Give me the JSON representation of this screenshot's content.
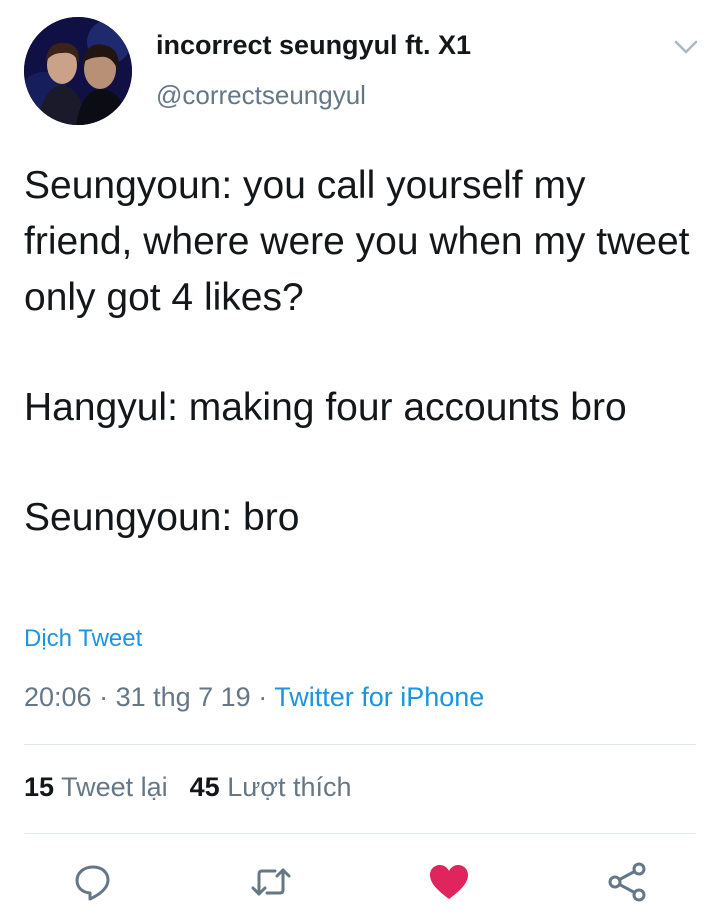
{
  "author": {
    "display_name": "incorrect seungyul ft. X1",
    "handle": "@correctseungyul"
  },
  "tweet": {
    "paragraphs": [
      "Seungyoun: you call yourself my friend, where were you when my tweet only got 4 likes?",
      "Hangyul: making four accounts bro",
      "Seungyoun: bro"
    ],
    "translate_label": "Dịch Tweet"
  },
  "meta": {
    "time": "20:06",
    "date": "31 thg 7 19",
    "separator": " · ",
    "source": "Twitter for iPhone"
  },
  "stats": {
    "retweets_count": "15",
    "retweets_label": "Tweet lại",
    "likes_count": "45",
    "likes_label": "Lượt thích"
  },
  "actions": [
    {
      "icon": "reply-icon"
    },
    {
      "icon": "retweet-icon"
    },
    {
      "icon": "heart-icon",
      "active": true
    },
    {
      "icon": "share-icon"
    }
  ],
  "colors": {
    "link": "#1b95e0",
    "secondary_text": "#657786",
    "liked": "#e0245e",
    "action_icon": "#657786"
  }
}
